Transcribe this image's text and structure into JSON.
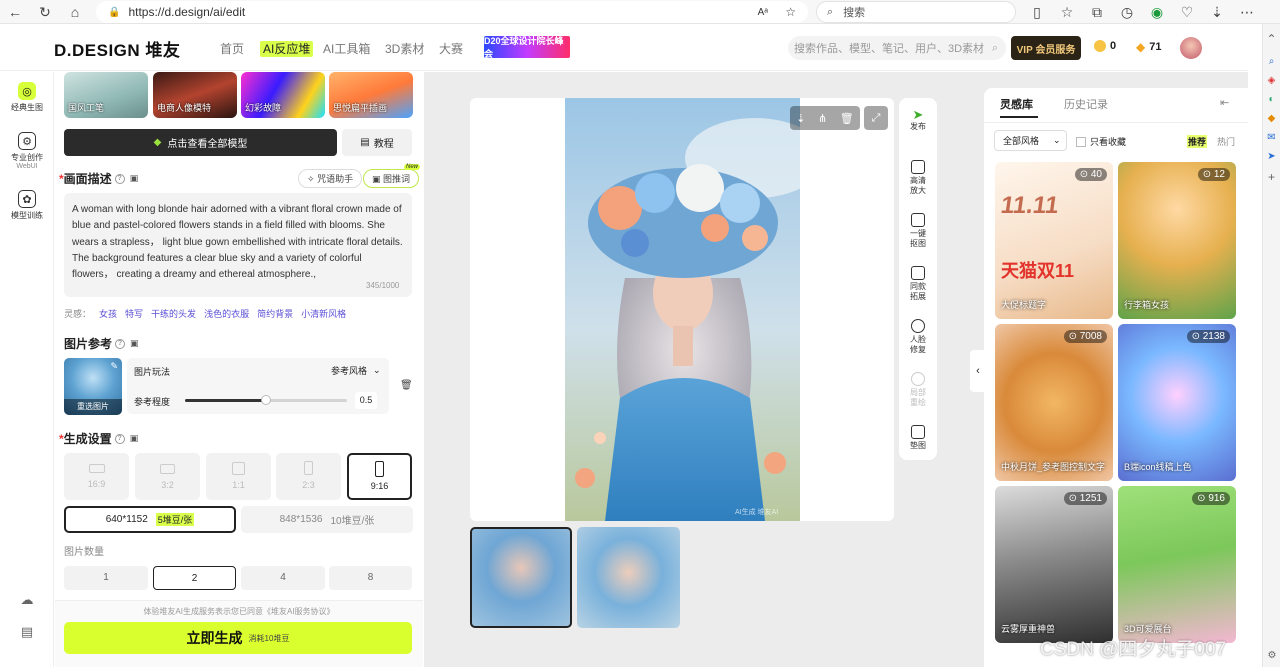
{
  "browser": {
    "url": "https://d.design/ai/edit",
    "search_placeholder": "搜索"
  },
  "header": {
    "logo": "D.DESIGN 堆友",
    "nav": [
      "首页",
      "AI反应堆",
      "AI工具箱",
      "3D素材",
      "大赛"
    ],
    "banner": "D20全球设计院长峰会",
    "search_placeholder": "搜索作品、模型、笔记、用户、3D素材",
    "vip_label": "VIP 会员服务",
    "coins": "0",
    "points": "71"
  },
  "rail": {
    "items": [
      "经典生图",
      "专业创作",
      "WebUI",
      "模型训练"
    ]
  },
  "panel": {
    "thumbs": [
      "国风工笔",
      "电商人像模特",
      "幻彩故障",
      "思悦扁平插画"
    ],
    "view_all_models": "点击查看全部模型",
    "tutorial": "教程",
    "desc_title": "画面描述",
    "spell_helper": "咒语助手",
    "img_to_prompt": "图推词",
    "new_badge": "New",
    "prompt": "A woman with long blonde hair adorned with a vibrant floral crown made of blue and pastel-colored flowers stands in a field filled with blooms. She wears a strapless， light blue gown embellished with intricate floral details. The background features a clear blue sky and a variety of colorful flowers， creating a dreamy and ethereal atmosphere.,",
    "char_count": "345/1000",
    "inspiration_label": "灵感：",
    "inspirations": [
      "女孩",
      "特写",
      "干练的头发",
      "浅色的衣服",
      "简约背景",
      "小清新风格"
    ],
    "ref_title": "图片参考",
    "reselect": "重选图片",
    "play_label": "图片玩法",
    "play_value": "参考风格",
    "degree_label": "参考程度",
    "degree_value": "0.5",
    "degree_fraction": 0.5,
    "gen_title": "生成设置",
    "ratios": [
      "16:9",
      "3:2",
      "1:1",
      "2:3",
      "9:16"
    ],
    "selected_ratio": "9:16",
    "size1": "640*1152",
    "size1_cost": "5堆豆/张",
    "size2": "848*1536",
    "size2_cost": "10堆豆/张",
    "count_label": "图片数量",
    "counts": [
      "1",
      "2",
      "4",
      "8"
    ],
    "selected_count": "2",
    "agreement": "体验堆友AI生成服务表示您已同意《堆友AI服务协议》",
    "generate": "立即生成",
    "generate_cost": "消耗10堆豆"
  },
  "canvas": {
    "watermark": "AI生成 堆友AI"
  },
  "toolbar": {
    "items": [
      "发布",
      "高清放大",
      "一键抠图",
      "同款拓展",
      "人脸修复",
      "局部重绘",
      "垫图"
    ]
  },
  "library": {
    "tabs": [
      "灵感库",
      "历史记录"
    ],
    "style_filter": "全部风格",
    "fav_only": "只看收藏",
    "sort": [
      "推荐",
      "热门"
    ],
    "cards": [
      {
        "label": "大促标题字",
        "count": "40"
      },
      {
        "label": "行李箱女孩",
        "count": "12"
      },
      {
        "label": "中秋月饼_参考图控制文字",
        "count": "7008"
      },
      {
        "label": "B端icon线稿上色",
        "count": "2138"
      },
      {
        "label": "云雾厚重神兽",
        "count": "1251"
      },
      {
        "label": "3D可爱展台",
        "count": "916"
      }
    ]
  },
  "watermark_bottom": "CSDN @四夕丸子007"
}
